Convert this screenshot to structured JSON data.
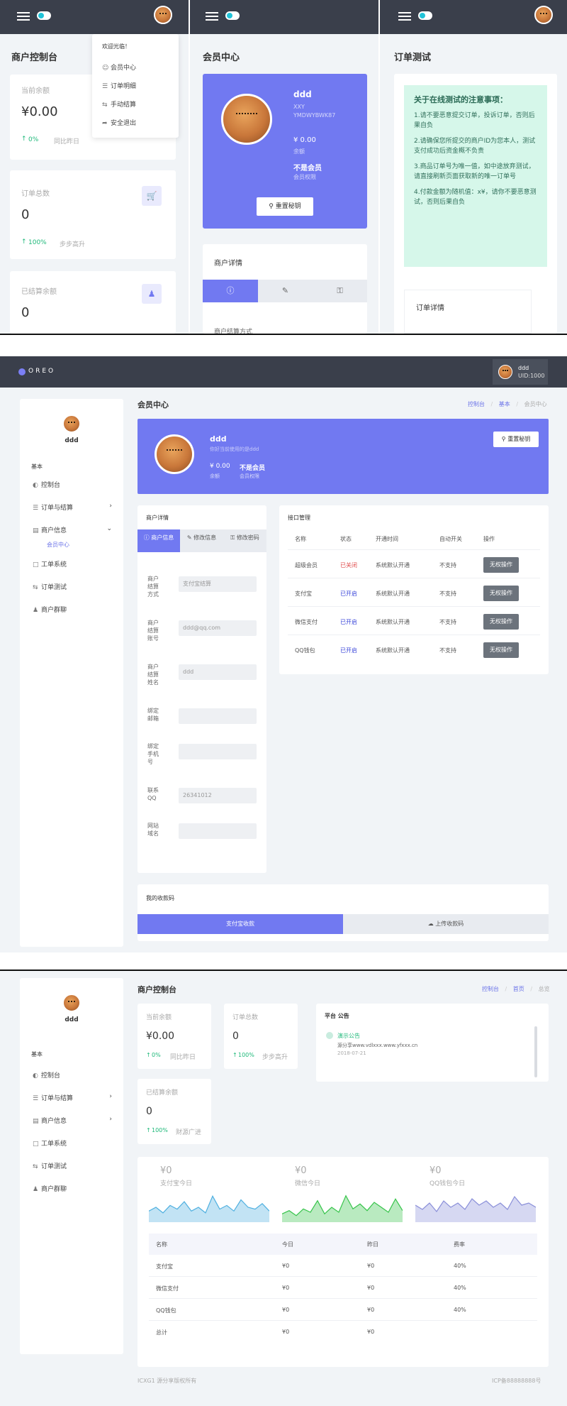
{
  "panel1": {
    "page_title": "商户控制台",
    "dropdown": {
      "greeting": "欢迎光临！",
      "items": [
        "会员中心",
        "订单明细",
        "手动结算",
        "安全退出"
      ]
    },
    "cards": [
      {
        "label": "当前余额",
        "value": "¥0.00",
        "trend": "0%",
        "trend_label": "同比昨日"
      },
      {
        "label": "订单总数",
        "value": "0",
        "trend": "100%",
        "trend_label": "步步高升"
      },
      {
        "label": "已结算余额",
        "value": "0"
      }
    ]
  },
  "panel2": {
    "page_title": "会员中心",
    "user": {
      "name": "ddd",
      "line1": "XXY",
      "line2": "YMDWYBWK87",
      "balance": "¥ 0.00",
      "balance_label": "余额",
      "vip": "不是会员",
      "vip_label": "会员权限"
    },
    "reset_button": "重置秘钥",
    "merchant_details": "商户详情",
    "partial_text": "商户结算方式"
  },
  "panel3": {
    "page_title": "订单测试",
    "notice_title": "关于在线测试的注意事项：",
    "notice_items": [
      "1.请不要恶意提交订单，投诉订单，否则后果自负",
      "2.请确保您所提交的商户ID为您本人，测试支付成功后资金概不负责",
      "3.商品订单号为唯一值，如中途放弃测试，请直接刷新页面获取新的唯一订单号",
      "4.付款金额为随机值：x¥，请你不要恶意测试，否则后果自负"
    ],
    "order_details": "订单详情"
  },
  "shot2": {
    "brand": "OREO",
    "user_name": "ddd",
    "user_id": "UID:1000",
    "page_title": "会员中心",
    "breadcrumbs": [
      "控制台",
      "基本",
      "会员中心"
    ],
    "sidebar_user": "ddd",
    "nav_section": "基本",
    "nav": [
      "控制台",
      "订单与结算",
      "商户信息",
      "会员中心",
      "工单系统",
      "订单测试",
      "商户群聊"
    ],
    "banner": {
      "name": "ddd",
      "sub": "你好当前使用的是ddd",
      "balance": "¥ 0.00",
      "balance_label": "余额",
      "vip": "不是会员",
      "vip_label": "会员权限"
    },
    "reset_button": "重置秘钥",
    "details_title": "商户详情",
    "tabs": [
      "商户信息",
      "修改信息",
      "修改密码"
    ],
    "fields": [
      {
        "label": "商户结算方式",
        "value": "支付宝结算"
      },
      {
        "label": "商户结算账号",
        "value": "ddd@qq.com"
      },
      {
        "label": "商户结算姓名",
        "value": "ddd"
      },
      {
        "label": "绑定邮箱",
        "value": ""
      },
      {
        "label": "绑定手机号",
        "value": ""
      },
      {
        "label": "联系QQ",
        "value": "26341012"
      },
      {
        "label": "网站域名",
        "value": ""
      }
    ],
    "iface_title": "接口管理",
    "iface_cols": [
      "名称",
      "状态",
      "开通时间",
      "自动开关",
      "操作"
    ],
    "iface_rows": [
      {
        "name": "超级会员",
        "status": "已关闭",
        "time": "系统默认开通",
        "auto": "不支持",
        "op": "无权操作"
      },
      {
        "name": "支付宝",
        "status": "已开启",
        "time": "系统默认开通",
        "auto": "不支持",
        "op": "无权操作"
      },
      {
        "name": "微信支付",
        "status": "已开启",
        "time": "系统默认开通",
        "auto": "不支持",
        "op": "无权操作"
      },
      {
        "name": "QQ钱包",
        "status": "已开启",
        "time": "系统默认开通",
        "auto": "不支持",
        "op": "无权操作"
      }
    ],
    "qr_title": "我的收款码",
    "qr_tabs": [
      "支付宝收款",
      "上传收款码"
    ]
  },
  "shot3": {
    "page_title": "商户控制台",
    "breadcrumbs": [
      "控制台",
      "首页",
      "总览"
    ],
    "sidebar_user": "ddd",
    "nav_section": "基本",
    "nav": [
      "控制台",
      "订单与结算",
      "商户信息",
      "工单系统",
      "订单测试",
      "商户群聊"
    ],
    "cards": [
      {
        "label": "当前余额",
        "value": "¥0.00",
        "trend": "0%",
        "trend_label": "同比昨日"
      },
      {
        "label": "订单总数",
        "value": "0",
        "trend": "100%",
        "trend_label": "步步高升"
      },
      {
        "label": "已结算余额",
        "value": "0",
        "trend": "100%",
        "trend_label": "财源广进"
      }
    ],
    "announce_title": "平台 公告",
    "announce_item_title": "演示公告",
    "announce_item_text": "源分享www.vdlxxx.www.yfxxx.cn",
    "announce_item_date": "2018-07-21",
    "stats": [
      {
        "value": "¥0",
        "label": "支付宝今日"
      },
      {
        "value": "¥0",
        "label": "微信今日"
      },
      {
        "value": "¥0",
        "label": "QQ钱包今日"
      }
    ],
    "table_cols": [
      "名称",
      "今日",
      "昨日",
      "费率"
    ],
    "table_rows": [
      [
        "支付宝",
        "¥0",
        "¥0",
        "40%"
      ],
      [
        "微信支付",
        "¥0",
        "¥0",
        "40%"
      ],
      [
        "QQ钱包",
        "¥0",
        "¥0",
        "40%"
      ],
      [
        "总计",
        "¥0",
        "¥0",
        ""
      ]
    ],
    "footer_left": "ICXG1 源分享版权所有",
    "footer_right": "ICP备88888888号"
  },
  "colors": {
    "accent": "#7179f1",
    "dark": "#3a3f4b",
    "green": "#1fb97a",
    "notice_bg": "#d6f7ea"
  },
  "chart_data": [
    {
      "type": "area",
      "series": [
        {
          "values": [
            6,
            8,
            5,
            9,
            7,
            11,
            6,
            8,
            5,
            14,
            7,
            9,
            6,
            12,
            8,
            7,
            10,
            6
          ]
        }
      ],
      "color": "#4fb0e0"
    },
    {
      "type": "area",
      "series": [
        {
          "values": [
            5,
            7,
            4,
            8,
            6,
            13,
            5,
            9,
            6,
            16,
            8,
            11,
            7,
            12,
            9,
            6,
            14,
            7
          ]
        }
      ],
      "color": "#36c44a"
    },
    {
      "type": "area",
      "series": [
        {
          "values": [
            8,
            6,
            9,
            5,
            10,
            7,
            9,
            6,
            11,
            8,
            10,
            7,
            9,
            6,
            12,
            8,
            9,
            7
          ]
        }
      ],
      "color": "#8a8fd9"
    }
  ]
}
